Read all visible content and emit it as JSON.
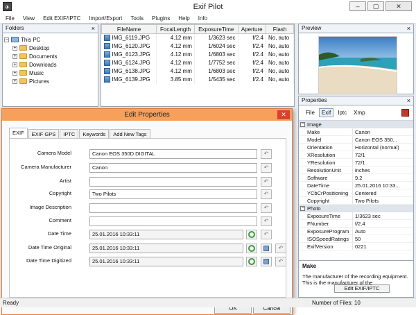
{
  "app": {
    "title": "Exif Pilot",
    "icon_name": "app-logo-icon",
    "window_buttons": [
      "–",
      "▢",
      "✕"
    ]
  },
  "menu": [
    "File",
    "View",
    "Edit EXIF/IPTC",
    "Import/Export",
    "Tools",
    "Plugins",
    "Help",
    "Info"
  ],
  "folders": {
    "title": "Folders",
    "close": "×",
    "root": "This PC",
    "items": [
      "Desktop",
      "Documents",
      "Downloads",
      "Music",
      "Pictures"
    ]
  },
  "files": {
    "columns": [
      "FileName",
      "FocalLength",
      "ExposureTime",
      "Aperture",
      "Flash"
    ],
    "rows": [
      [
        "IMG_6119.JPG",
        "4.12 mm",
        "1/3623 sec",
        "f/2.4",
        "No, auto"
      ],
      [
        "IMG_6120.JPG",
        "4.12 mm",
        "1/6024 sec",
        "f/2.4",
        "No, auto"
      ],
      [
        "IMG_6123.JPG",
        "4.12 mm",
        "1/6803 sec",
        "f/2.4",
        "No, auto"
      ],
      [
        "IMG_6124.JPG",
        "4.12 mm",
        "1/7752 sec",
        "f/2.4",
        "No, auto"
      ],
      [
        "IMG_6138.JPG",
        "4.12 mm",
        "1/6803 sec",
        "f/2.4",
        "No, auto"
      ],
      [
        "IMG_6139.JPG",
        "3.85 mm",
        "1/5435 sec",
        "f/2.4",
        "No, auto"
      ]
    ]
  },
  "preview": {
    "title": "Preview",
    "close": "×"
  },
  "properties": {
    "title": "Properties",
    "close": "×",
    "tabs": [
      "File",
      "Exif",
      "Iptc",
      "Xmp"
    ],
    "active_tab": "Exif",
    "sections": [
      {
        "name": "Image",
        "rows": [
          [
            "Make",
            "Canon"
          ],
          [
            "Model",
            "Canon EOS 350..."
          ],
          [
            "Orientation",
            "Horizontal (normal)"
          ],
          [
            "XResolution",
            "72/1"
          ],
          [
            "YResolution",
            "72/1"
          ],
          [
            "ResolutionUnit",
            "inches"
          ],
          [
            "Software",
            "9.2"
          ],
          [
            "DateTime",
            "25.01.2016 10:33..."
          ],
          [
            "YCbCrPositioning",
            "Centered"
          ],
          [
            "Copyright",
            "Two Pilots"
          ]
        ]
      },
      {
        "name": "Photo",
        "rows": [
          [
            "ExposureTime",
            "1/3623 sec"
          ],
          [
            "FNumber",
            "f/2.4"
          ],
          [
            "ExposureProgram",
            "Auto"
          ],
          [
            "ISOSpeedRatings",
            "50"
          ],
          [
            "ExifVersion",
            "0221"
          ]
        ]
      }
    ],
    "desc_title": "Make",
    "desc_text": "The manufacturer of the recording equipment. This is the manufacturer of the",
    "edit_button": "Edit EXIF/IPTC"
  },
  "dialog": {
    "title": "Edit Properties",
    "close": "✕",
    "tabs": [
      "EXIF",
      "EXIF GPS",
      "IPTC",
      "Keywords",
      "Add New Tags"
    ],
    "active_tab": "EXIF",
    "fields": [
      {
        "label": "Camera Model",
        "value": "Canon EOS 350D DIGITAL"
      },
      {
        "label": "Camera Manufacturer",
        "value": "Canon"
      },
      {
        "label": "Artist",
        "value": ""
      },
      {
        "label": "Copyright",
        "value": "Two Pilots"
      },
      {
        "label": "Image Description",
        "value": ""
      },
      {
        "label": "Comment",
        "value": ""
      },
      {
        "label": "Date Time",
        "value": "25.01.2016 10:33:11"
      },
      {
        "label": "Date Time Original",
        "value": "25.01.2016 10:33:11"
      },
      {
        "label": "Date Time Digitized",
        "value": "25.01.2016 10:33:11"
      }
    ],
    "ok": "OK",
    "cancel": "Cancel"
  },
  "status": {
    "left": "Ready",
    "count": "Number of Files: 10"
  },
  "colors": {
    "dialog_title": "#f6a05b",
    "dialog_close": "#d9402e",
    "panel_border": "#9aa7b6"
  }
}
